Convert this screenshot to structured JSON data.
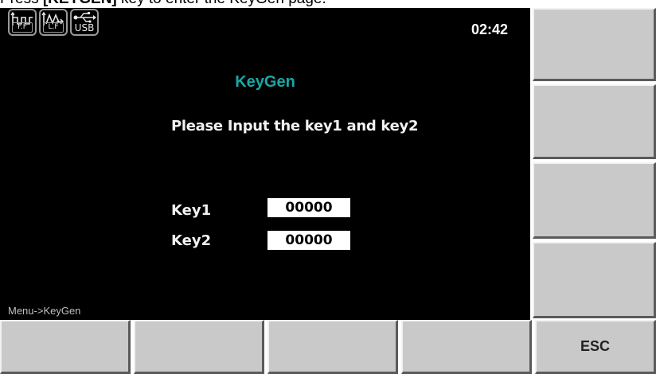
{
  "instruction": {
    "prefix": "Press ",
    "key": "[KEYGEN]",
    "suffix": " key to enter the KeyGen page."
  },
  "status_bar": {
    "icons": [
      {
        "name": "ff-icon",
        "label": "F.F"
      },
      {
        "name": "lf-icon",
        "label": "L.F"
      },
      {
        "name": "usb-icon",
        "label": "USB"
      }
    ],
    "time": "02:42"
  },
  "main": {
    "title": "KeyGen",
    "prompt": "Please Input the key1 and key2",
    "key1": {
      "label": "Key1",
      "value": "00000"
    },
    "key2": {
      "label": "Key2",
      "value": "00000"
    },
    "breadcrumb": "Menu->KeyGen"
  },
  "colors": {
    "title": "#1aa7a7",
    "screen_bg": "#000000",
    "softkey_bg": "#c9c9c9"
  },
  "softkeys_right": [
    "",
    "",
    "",
    ""
  ],
  "softkeys_bottom": [
    "",
    "",
    "",
    "",
    "ESC"
  ]
}
